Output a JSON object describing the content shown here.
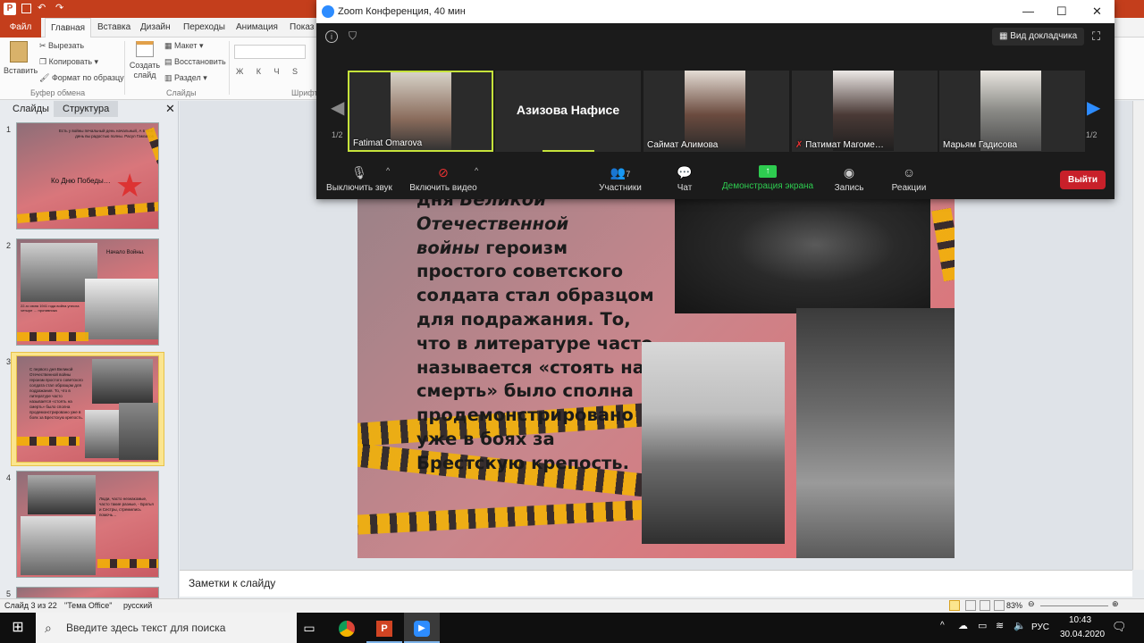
{
  "powerpoint": {
    "tabs": [
      "Файл",
      "Главная",
      "Вставка",
      "Дизайн",
      "Переходы",
      "Анимация",
      "Показ сл"
    ],
    "ribbon": {
      "paste": "Вставить",
      "cut": "Вырезать",
      "copy": "Копировать",
      "format_painter": "Формат по образцу",
      "clipboard_group": "Буфер обмена",
      "new_slide": "Создать слайд",
      "layout": "Макет",
      "reset": "Восстановить",
      "section": "Раздел",
      "slides_group": "Слайды",
      "font_group": "Шрифт"
    },
    "slide_panel": {
      "tab_slides": "Слайды",
      "tab_outline": "Структура",
      "thumbs": [
        {
          "num": "1",
          "title": "Ко Дню Победы…",
          "quote": "Есть у войны печальный день начальный, А в этот день вы радостью полны. Расул Гамзатов"
        },
        {
          "num": "2",
          "title": "Начало Войны.",
          "text": "22-го июня 1941 года война унесла четыре … противника"
        },
        {
          "num": "3",
          "text": "С первого дня Великой Отечественной войны героизм простого советского солдата стал образцом для подражания. То, что в литературе часто называется «стоять на смерть» было сполна продемонстрировано уже в боях за Брестскую крепость."
        },
        {
          "num": "4",
          "text": "Люди, часто незнакомые, часто такие разные, - Братья и Сестры, стремились помочь…"
        },
        {
          "num": "5"
        }
      ]
    },
    "slide": {
      "line1": "дня ",
      "line1_italic": "Великой",
      "line2_italic": "Отечественной",
      "line3_italic": "войны",
      "body": " героизм простого советского солдата стал образцом для подражания. То, что в литературе часто называется «стоять на смерть» было сполна продемонстрировано уже в боях за Брестскую крепость."
    },
    "notes_placeholder": "Заметки к слайду",
    "status": {
      "slide_counter": "Слайд 3 из 22",
      "theme": "\"Тема Office\"",
      "language": "русский",
      "zoom": "83%"
    }
  },
  "zoom": {
    "title": "Zoom Конференция, 40 мин",
    "speaker_view": "Вид докладчика",
    "page_left": "1/2",
    "page_right": "1/2",
    "participants": [
      {
        "name": "Fatimat Omarova",
        "active": true
      },
      {
        "name": "Азизова Нафисе",
        "video": false
      },
      {
        "name": "Саймат Алимова"
      },
      {
        "name": "Патимат Магоме…",
        "muted": true
      },
      {
        "name": "Марьям Гадисова"
      }
    ],
    "controls": {
      "mute": "Выключить звук",
      "video": "Включить видео",
      "participants": "Участники",
      "participants_count": "7",
      "chat": "Чат",
      "share": "Демонстрация экрана",
      "record": "Запись",
      "reactions": "Реакции",
      "leave": "Выйти"
    }
  },
  "taskbar": {
    "search_placeholder": "Введите здесь текст для поиска",
    "language": "РУС",
    "time": "10:43",
    "date": "30.04.2020"
  }
}
